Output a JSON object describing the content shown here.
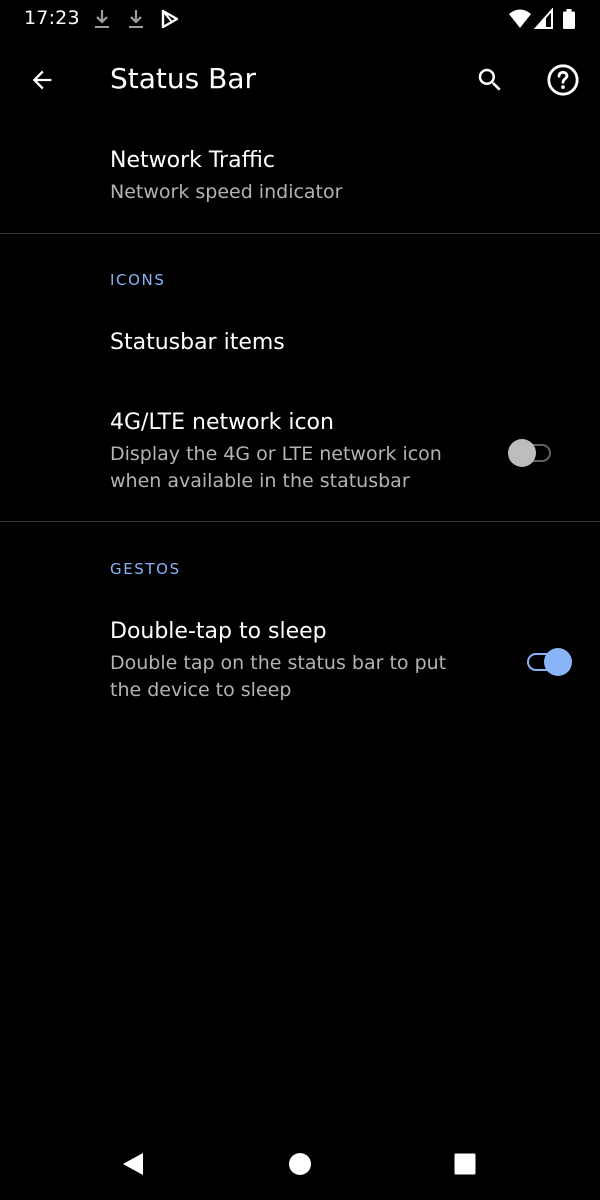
{
  "status_bar": {
    "time": "17:23",
    "icons": [
      "download-icon",
      "download-icon",
      "play-store-icon",
      "wifi-icon",
      "signal-icon",
      "battery-icon"
    ]
  },
  "app_bar": {
    "title": "Status Bar",
    "back_icon": "arrow-back-icon",
    "search_icon": "search-icon",
    "help_icon": "help-icon"
  },
  "preferences": {
    "network_traffic": {
      "title": "Network Traffic",
      "summary": "Network speed indicator"
    },
    "icons_category": "ICONS",
    "statusbar_items": {
      "title": "Statusbar items"
    },
    "lte_icon": {
      "title": "4G/LTE network icon",
      "summary": "Display the 4G or LTE network icon when available in the statusbar",
      "enabled": false
    },
    "gestures_category": "GESTOS",
    "double_tap": {
      "title": "Double-tap to sleep",
      "summary": "Double tap on the status bar to put the device to sleep",
      "enabled": true
    }
  },
  "nav_bar": {
    "back": "nav-back-icon",
    "home": "nav-home-icon",
    "recents": "nav-recents-icon"
  },
  "colors": {
    "background": "#000000",
    "accent": "#8ab4f8",
    "secondary_text": "#b3b3b3",
    "divider": "#3a3a3a"
  }
}
